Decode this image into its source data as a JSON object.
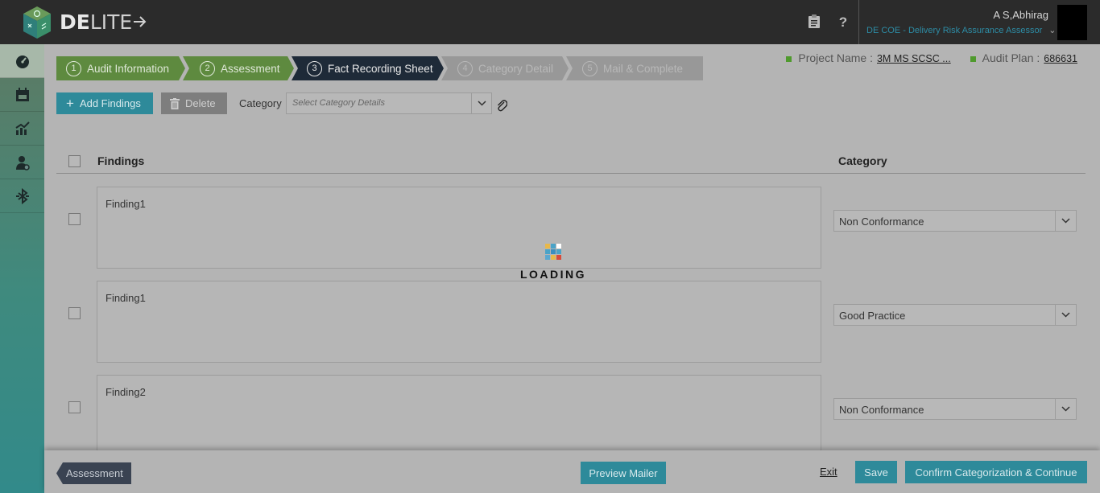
{
  "app": {
    "logo_bold": "DE",
    "logo_light": "LITE"
  },
  "topbar": {
    "clipboard_icon": "clipboard-icon",
    "help_label": "?",
    "user_name": "A S,Abhirag",
    "user_role": "DE COE - Delivery Risk Assurance Assessor"
  },
  "sidebar": {
    "items": [
      {
        "icon": "dashboard-icon",
        "active": true
      },
      {
        "icon": "calendar-icon",
        "active": false
      },
      {
        "icon": "chart-icon",
        "active": false
      },
      {
        "icon": "user-settings-icon",
        "active": false
      },
      {
        "icon": "bluetooth-transfer-icon",
        "active": false
      }
    ]
  },
  "steps": [
    {
      "num": "1",
      "label": "Audit Information",
      "state": "done"
    },
    {
      "num": "2",
      "label": "Assessment",
      "state": "done"
    },
    {
      "num": "3",
      "label": "Fact Recording Sheet",
      "state": "current"
    },
    {
      "num": "4",
      "label": "Category Detail",
      "state": "todo"
    },
    {
      "num": "5",
      "label": "Mail & Complete",
      "state": "todo"
    }
  ],
  "project": {
    "name_label": "Project Name :",
    "name_value": "3M MS SCSC ...",
    "plan_label": "Audit Plan :",
    "plan_value": "686631"
  },
  "toolbar": {
    "add_label": "Add Findings",
    "delete_label": "Delete",
    "category_label": "Category",
    "category_placeholder": "Select Category Details"
  },
  "table": {
    "col_findings": "Findings",
    "col_category": "Category",
    "rows": [
      {
        "finding": "Finding1",
        "category": "Non Conformance"
      },
      {
        "finding": "Finding1",
        "category": "Good Practice"
      },
      {
        "finding": "Finding2",
        "category": "Non Conformance"
      }
    ]
  },
  "loading": {
    "text": "LOADING"
  },
  "footer": {
    "back_label": "Assessment",
    "preview_label": "Preview Mailer",
    "exit_label": "Exit",
    "save_label": "Save",
    "confirm_label": "Confirm Categorization & Continue"
  },
  "colors": {
    "accent": "#2e8a9a",
    "step_done": "#5e8a3f",
    "step_current": "#1e2a38",
    "status_square": "#4f9a2d"
  }
}
